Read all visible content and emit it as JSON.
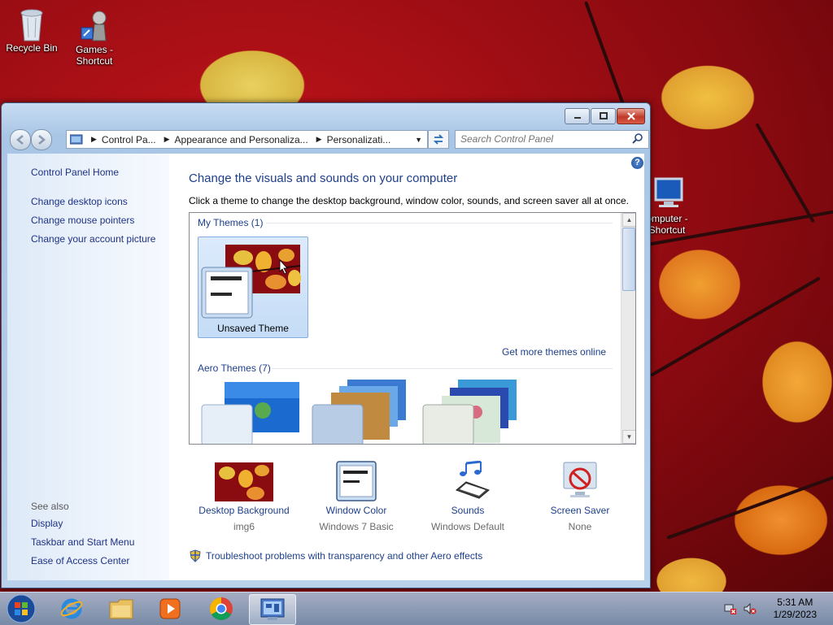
{
  "desktop": {
    "icons": [
      {
        "label_1": "Recycle Bin",
        "label_2": ""
      },
      {
        "label_1": "Games -",
        "label_2": "Shortcut"
      },
      {
        "label_1": "omputer -",
        "label_2": "Shortcut"
      }
    ]
  },
  "window": {
    "breadcrumbs": [
      "Control Pa...",
      "Appearance and Personaliza...",
      "Personalizati..."
    ],
    "search_placeholder": "Search Control Panel",
    "help_glyph": "?"
  },
  "sidebar": {
    "home": "Control Panel Home",
    "links": [
      "Change desktop icons",
      "Change mouse pointers",
      "Change your account picture"
    ],
    "see_also_heading": "See also",
    "see_also": [
      "Display",
      "Taskbar and Start Menu",
      "Ease of Access Center"
    ]
  },
  "main": {
    "title": "Change the visuals and sounds on your computer",
    "subtitle": "Click a theme to change the desktop background, window color, sounds, and screen saver all at once.",
    "my_themes_heading": "My Themes (1)",
    "my_themes": [
      {
        "name": "Unsaved Theme",
        "selected": true
      }
    ],
    "get_more_link": "Get more themes online",
    "aero_heading": "Aero Themes (7)",
    "bottom": [
      {
        "link": "Desktop Background",
        "value": "img6",
        "icon": "desktop-background-icon"
      },
      {
        "link": "Window Color",
        "value": "Windows 7 Basic",
        "icon": "window-color-icon"
      },
      {
        "link": "Sounds",
        "value": "Windows Default",
        "icon": "sounds-icon"
      },
      {
        "link": "Screen Saver",
        "value": "None",
        "icon": "screen-saver-icon"
      }
    ],
    "troubleshoot_link": "Troubleshoot problems with transparency and other Aero effects"
  },
  "taskbar": {
    "time": "5:31 AM",
    "date": "1/29/2023"
  }
}
